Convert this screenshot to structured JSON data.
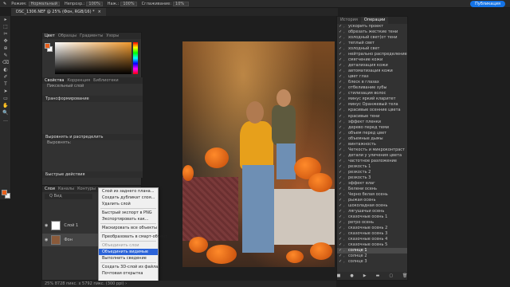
{
  "options_bar": {
    "mode_label": "Режим:",
    "mode_value": "Нормальный",
    "opacity_label": "Непрозр.:",
    "opacity_value": "100%",
    "flow_label": "Наж.:",
    "flow_value": "100%",
    "smoothing_label": "Сглаживание:",
    "smoothing_value": "10%",
    "publish_label": "Публикация"
  },
  "document_tab": {
    "title": "DSC_1306.NEF @ 25% (Фон, RGB/16) *",
    "close": "×"
  },
  "tools": [
    "▸",
    "⬚",
    "✂",
    "✥",
    "⊕",
    "✎",
    "⌫",
    "◐",
    "✐",
    "T",
    "➤",
    "▭",
    "✋",
    "🔍",
    "…"
  ],
  "color_panel": {
    "tabs": [
      "Цвет",
      "Образцы",
      "Градиенты",
      "Узоры"
    ],
    "active_tab": "Цвет",
    "fg_color": "#e8601c",
    "bg_color": "#ffffff"
  },
  "properties_panel": {
    "tabs": [
      "Свойства",
      "Коррекция",
      "Библиотеки"
    ],
    "active_tab": "Свойства",
    "pixel_layer": "Пиксельный слой",
    "transform": "Трансформирование",
    "align": "Выровнять и распределить",
    "align_sub": "Выровнять:",
    "quick_actions": "Быстрые действия"
  },
  "layers_panel": {
    "tabs": [
      "Слои",
      "Каналы",
      "Контуры"
    ],
    "active_tab": "Слои",
    "search": "Q Вид",
    "layers": [
      {
        "name": "Слой 1"
      },
      {
        "name": "Фон"
      }
    ]
  },
  "context_menu": {
    "items": [
      {
        "label": "Слой из заднего плана...",
        "state": "normal"
      },
      {
        "label": "Создать дубликат слоя...",
        "state": "normal"
      },
      {
        "label": "Удалить слой",
        "state": "normal"
      },
      {
        "sep": true
      },
      {
        "label": "Быстрый экспорт в PNG",
        "state": "normal"
      },
      {
        "label": "Экспортировать как...",
        "state": "normal"
      },
      {
        "sep": true
      },
      {
        "label": "Маскировать все объекты",
        "state": "normal"
      },
      {
        "sep": true
      },
      {
        "label": "Преобразовать в смарт-объект",
        "state": "normal"
      },
      {
        "sep": true
      },
      {
        "label": "Объединить слои",
        "state": "disabled"
      },
      {
        "label": "Объединить видимые",
        "state": "highlighted"
      },
      {
        "label": "Выполнить сведение",
        "state": "normal"
      },
      {
        "sep": true
      },
      {
        "label": "Создать 3D-слой из файла...",
        "state": "normal"
      },
      {
        "label": "Почтовая открытка",
        "state": "normal"
      }
    ]
  },
  "status_bar": {
    "text": "25%    8728 пикс. x 5792 пикс. (300 ppi)   ›"
  },
  "right_panel": {
    "tabs": [
      "История",
      "Операции"
    ],
    "active_tab": "Операции",
    "actions": [
      {
        "label": "ускорить проект"
      },
      {
        "label": "обрезать жесткие тени"
      },
      {
        "label": "холодный свет(от тени"
      },
      {
        "label": "теплый свет"
      },
      {
        "label": "холодный свет"
      },
      {
        "label": "нейтрально распределение"
      },
      {
        "label": "смягчение кожи"
      },
      {
        "label": "детализация кожи"
      },
      {
        "label": "автоматизация кожи"
      },
      {
        "label": "цвет глаз"
      },
      {
        "label": "блеск в глазах"
      },
      {
        "label": "отбеливание зубы"
      },
      {
        "label": "стилизация волос"
      },
      {
        "label": "минус яркий кларитет"
      },
      {
        "label": "минус Оранжевый тела"
      },
      {
        "label": "красивые осенние цвета"
      },
      {
        "label": "красивые тени"
      },
      {
        "label": "эффект пленки"
      },
      {
        "label": "дерево перед теми"
      },
      {
        "label": "объем перед цвет"
      },
      {
        "label": "объемные дымы"
      },
      {
        "label": "винтажность"
      },
      {
        "label": "Четкость и микроконтраст"
      },
      {
        "label": "детали у уличения цвета"
      },
      {
        "label": "частотное разложение"
      },
      {
        "label": "резкость 1"
      },
      {
        "label": "резкость 2"
      },
      {
        "label": "резкость 3"
      },
      {
        "label": "эффект влаг"
      },
      {
        "label": "Белени осень"
      },
      {
        "label": "Черно белая осень"
      },
      {
        "label": "рыжая осень"
      },
      {
        "label": "шоколадная осень"
      },
      {
        "label": "лягушачьи осень"
      },
      {
        "label": "сказочные осень 1"
      },
      {
        "label": "ретро осень"
      },
      {
        "label": "сказочные осень 2"
      },
      {
        "label": "сказочные осень 3"
      },
      {
        "label": "сказочные осень 4"
      },
      {
        "label": "сказочные осень 5"
      },
      {
        "label": "солнце 1"
      },
      {
        "label": "солнце 2"
      },
      {
        "label": "солнце 3"
      }
    ],
    "selected_index": 40,
    "bottom_controls": [
      "■",
      "●",
      "▶",
      "▬",
      "▢",
      "🗑"
    ]
  }
}
